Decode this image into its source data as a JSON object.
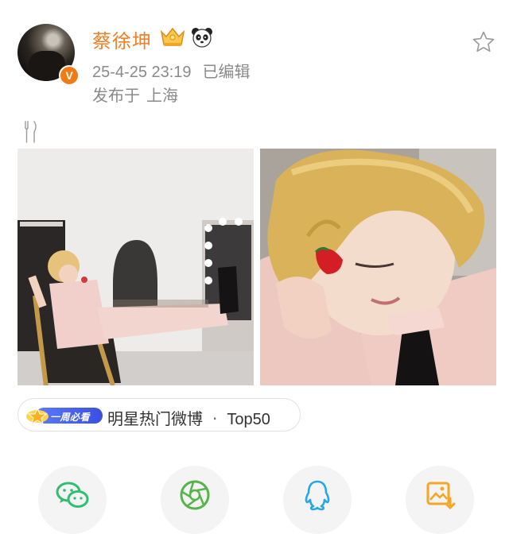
{
  "post": {
    "author": "蔡徐坤",
    "verified_mark": "V",
    "timestamp": "25-4-25 23:19",
    "edited_label": "已编辑",
    "location_prefix": "发布于",
    "location": "上海",
    "content_icon": "fork-and-knife",
    "images": [
      {
        "name": "photo-dressing-room"
      },
      {
        "name": "photo-strawberry"
      }
    ],
    "icons": {
      "crown": "crown-badge",
      "panda": "panda-emoji",
      "favorite": "star-outline"
    }
  },
  "hot_badge": {
    "badge_text": "一周必看",
    "category": "明星热门微博",
    "separator": "·",
    "rank": "Top50"
  },
  "share_bar": [
    {
      "name": "wechat",
      "color": "#2fbf71"
    },
    {
      "name": "moments",
      "color": "#56b54a"
    },
    {
      "name": "qq",
      "color": "#26a6e6"
    },
    {
      "name": "save-image",
      "color": "#f5a623"
    }
  ],
  "colors": {
    "name": "#f0802a",
    "meta": "#8a8a8a",
    "badge_blue": "#4b62f0",
    "verified": "#f07a13"
  }
}
